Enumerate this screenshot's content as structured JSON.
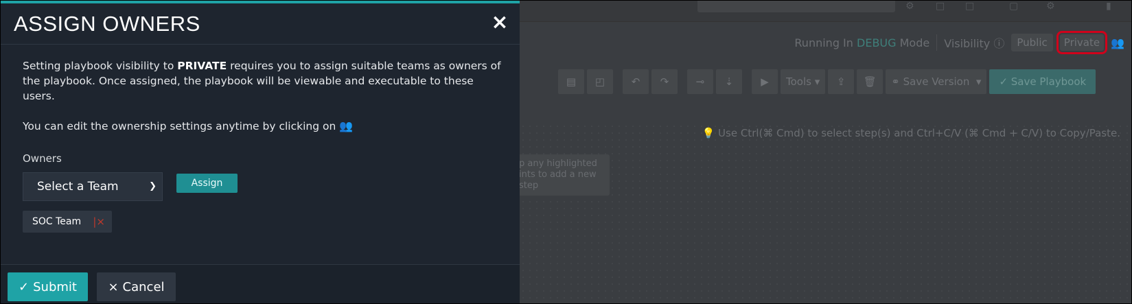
{
  "modal": {
    "title": "ASSIGN OWNERS",
    "close_icon": "×",
    "body": {
      "line1_prefix": "Setting playbook visibility to ",
      "line1_bold": "PRIVATE",
      "line1_suffix": " requires you to assign suitable teams as owners of the playbook. Once assigned, the playbook will be viewable and executable to these users.",
      "line2": "You can edit the ownership settings anytime by clicking on "
    },
    "owners_label": "Owners",
    "team_select_value": "Select a Team",
    "assign_label": "Assign",
    "owner_tags": [
      {
        "label": "SOC Team",
        "remove_icon": "|×"
      }
    ],
    "footer": {
      "submit_icon": "✓",
      "submit_label": "Submit",
      "cancel_icon": "×",
      "cancel_label": "Cancel"
    }
  },
  "background_app": {
    "running_in_prefix": "Running In",
    "running_mode": "DEBUG",
    "running_in_suffix": "Mode",
    "visibility_label": "Visibility",
    "visibility_public": "Public",
    "visibility_private": "Private",
    "tools_label": "Tools",
    "save_version_label": "Save Version",
    "save_playbook_label": "Save Playbook",
    "hint_text": "Use Ctrl(⌘ Cmd) to select step(s) and Ctrl+C/V (⌘ Cmd + C/V) to Copy/Paste.",
    "tooltip_text": "p any highlighted\nints to add a new\nstep"
  },
  "colors": {
    "accent": "#1fa3a6",
    "modal_bg": "#1e252f",
    "highlight_box": "#d0021b"
  },
  "icons": {
    "team": "users-icon",
    "close": "close-icon",
    "check": "check-icon"
  }
}
